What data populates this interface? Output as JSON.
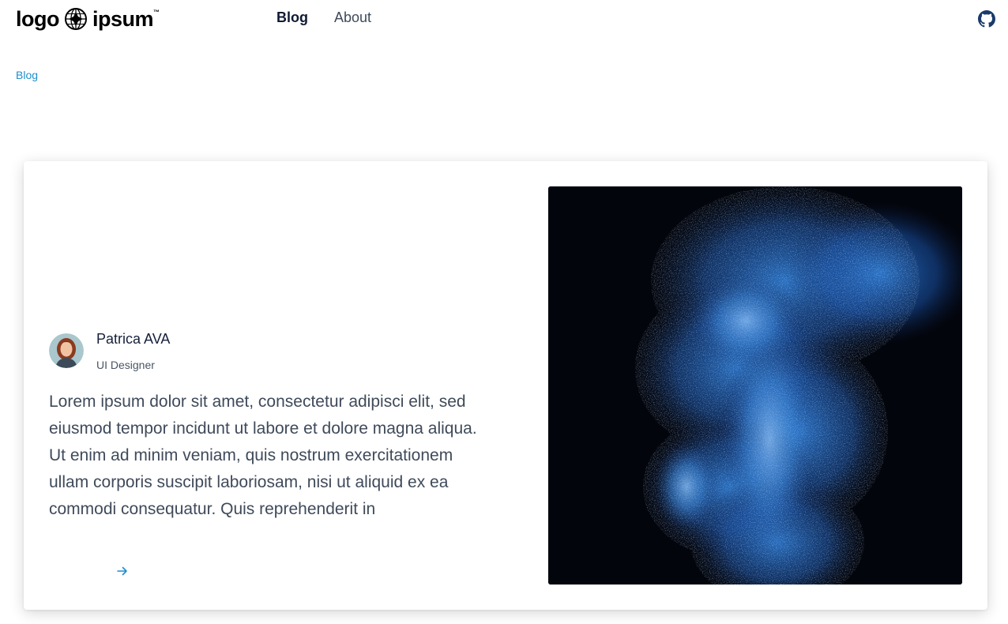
{
  "header": {
    "logo": {
      "left": "logo",
      "right": "ipsum",
      "trademark": "™"
    },
    "nav": [
      {
        "label": "Blog",
        "active": true
      },
      {
        "label": "About",
        "active": false
      }
    ],
    "github_icon": "github-icon"
  },
  "breadcrumb": {
    "label": "Blog"
  },
  "post": {
    "author": {
      "name": "Patrica AVA",
      "role": "UI Designer"
    },
    "excerpt": "Lorem ipsum dolor sit amet, consectetur adipisci elit, sed eiusmod tempor incidunt ut labore et dolore magna aliqua. Ut enim ad minim veniam, quis nostrum exercitationem ullam corporis suscipit laboriosam, nisi ut aliquid ex ea commodi consequatur. Quis reprehenderit in",
    "read_more_icon": "arrow-right-icon"
  },
  "colors": {
    "accent": "#1f8ecd",
    "heading": "#0f1a33",
    "text": "#3f4a5a"
  }
}
